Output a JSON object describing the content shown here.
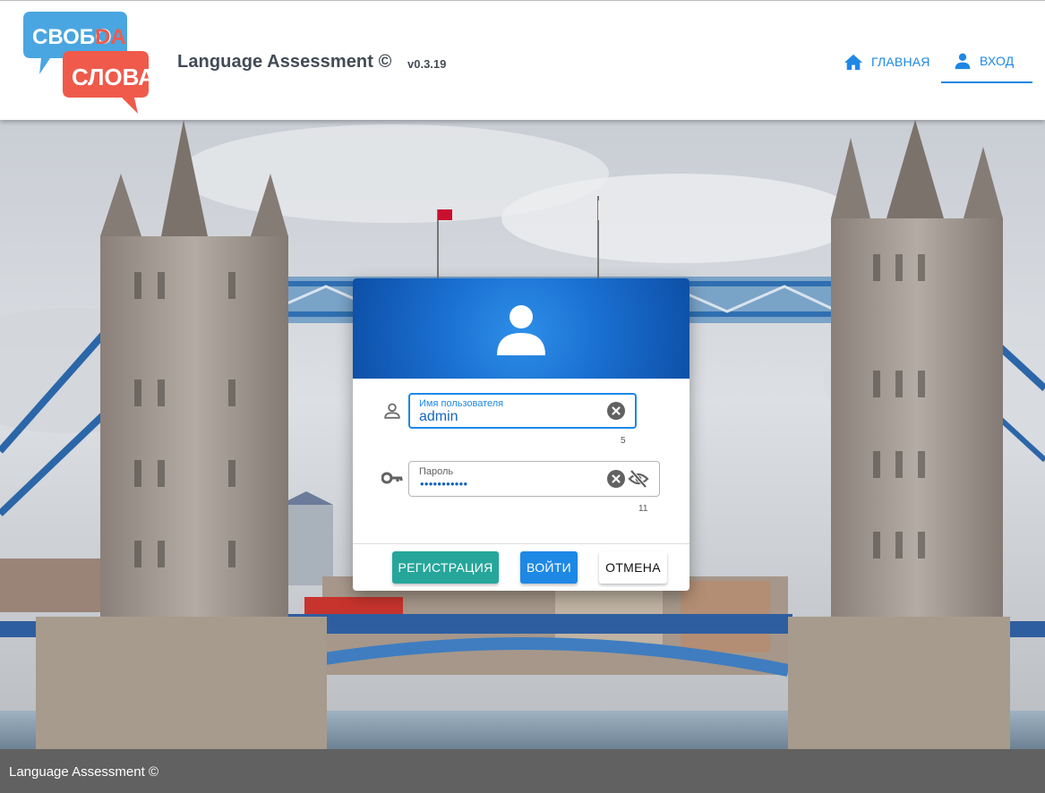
{
  "header": {
    "logo": {
      "line1_main": "СВОБО",
      "line1_accent": "DA",
      "line2": "СЛОВА"
    },
    "title": "Language Assessment ©",
    "version": "v0.3.19",
    "nav": [
      {
        "label": "ГЛАВНАЯ",
        "icon": "home-icon",
        "active": false
      },
      {
        "label": "ВХОД",
        "icon": "person-icon",
        "active": true
      }
    ]
  },
  "login": {
    "username": {
      "label": "Имя пользователя",
      "value": "admin",
      "counter": "5",
      "icon": "person-outline-icon"
    },
    "password": {
      "label": "Пароль",
      "masked_value": "•••••••••••",
      "counter": "11",
      "icon": "key-icon"
    },
    "buttons": {
      "register": "РЕГИСТРАЦИЯ",
      "login": "ВОЙТИ",
      "cancel": "ОТМЕНА"
    }
  },
  "footer": {
    "text": "Language Assessment ©"
  },
  "colors": {
    "accent": "#1e88e5",
    "register": "#26a69a",
    "banner": "#1a6fd1",
    "footer": "#616161",
    "header_text": "#424b56"
  }
}
